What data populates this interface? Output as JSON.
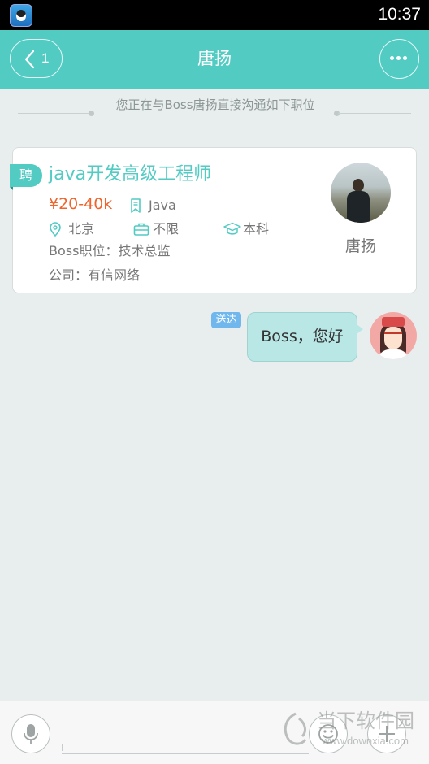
{
  "status_bar": {
    "time": "10:37"
  },
  "header": {
    "back_count": "1",
    "title": "唐扬"
  },
  "notice": "您正在与Boss唐扬直接沟通如下职位",
  "job_card": {
    "tag": "聘",
    "title": "java开发高级工程师",
    "salary": "¥20-40k",
    "skill": "Java",
    "city": "北京",
    "experience": "不限",
    "education": "本科",
    "boss_position": "Boss职位：技术总监",
    "company": "公司：有信网络",
    "boss_name": "唐扬"
  },
  "messages": [
    {
      "status": "送达",
      "text": "Boss，您好"
    }
  ],
  "input_bar": {
    "value": "",
    "placeholder": ""
  },
  "watermark": {
    "text": "当下软件园",
    "url": "www.downxia.com"
  },
  "colors": {
    "accent": "#52cbc3",
    "salary": "#f0632a",
    "delivered_badge": "#6fb7ec",
    "bubble": "#b8e7e6"
  }
}
